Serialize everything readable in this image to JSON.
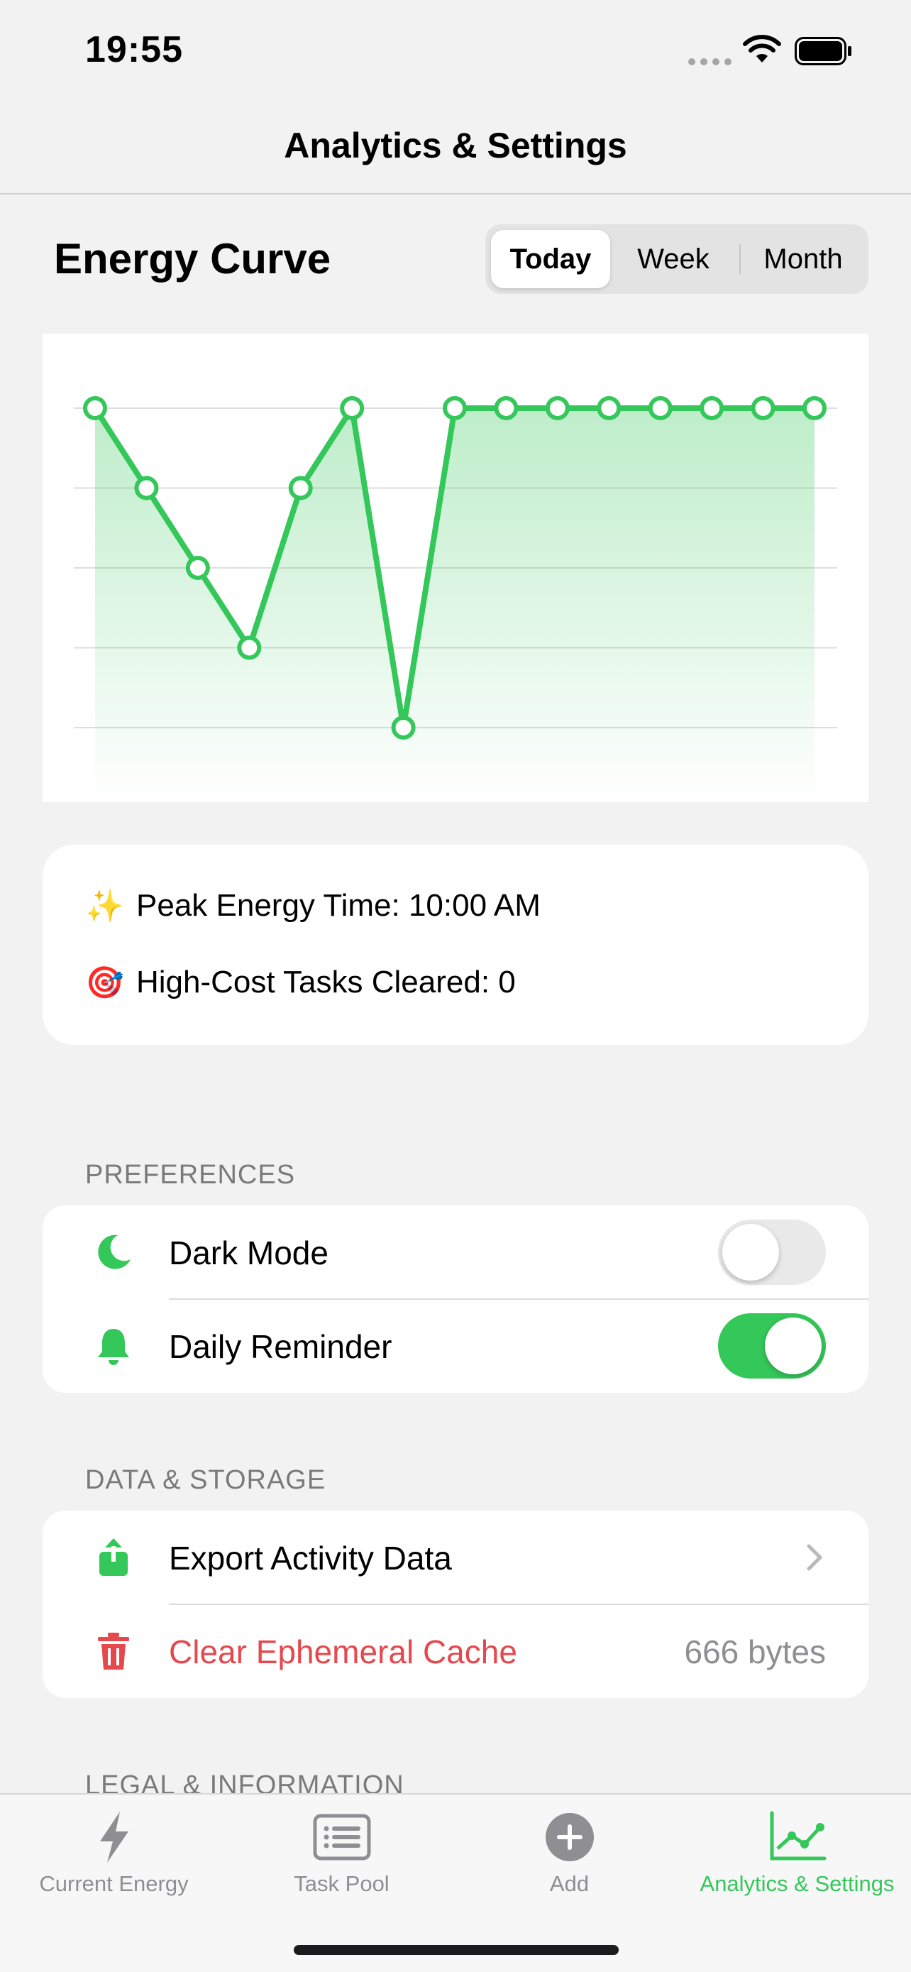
{
  "status_bar": {
    "time": "19:55"
  },
  "nav": {
    "title": "Analytics & Settings"
  },
  "energy": {
    "title": "Energy Curve",
    "segments": [
      "Today",
      "Week",
      "Month"
    ],
    "selected_segment": "Today"
  },
  "chart_data": {
    "type": "line",
    "x": [
      1,
      2,
      3,
      4,
      5,
      6,
      7,
      8,
      9,
      10,
      11,
      12,
      13,
      14,
      15
    ],
    "series": [
      {
        "values": [
          5,
          4,
          3,
          2,
          4,
          5,
          1,
          5,
          5,
          5,
          5,
          5,
          5,
          5,
          5
        ]
      }
    ],
    "ylim": [
      1,
      5
    ],
    "grid": true,
    "area_fill": true,
    "color": "#34c759"
  },
  "stats": {
    "peak": {
      "icon": "✨",
      "text": "Peak Energy Time: 10:00 AM"
    },
    "high_cost": {
      "icon": "🎯",
      "text": "High-Cost Tasks Cleared: 0"
    }
  },
  "preferences": {
    "header": "PREFERENCES",
    "dark_mode": {
      "label": "Dark Mode",
      "icon": "moon-icon",
      "enabled": false
    },
    "daily_reminder": {
      "label": "Daily Reminder",
      "icon": "bell-icon",
      "enabled": true
    }
  },
  "data_storage": {
    "header": "DATA & STORAGE",
    "export": {
      "label": "Export Activity Data",
      "icon": "share-icon"
    },
    "clear_cache": {
      "label": "Clear Ephemeral Cache",
      "value": "666 bytes",
      "icon": "trash-icon"
    }
  },
  "legal": {
    "header": "LEGAL & INFORMATION"
  },
  "tabs": [
    {
      "label": "Current Energy",
      "icon": "bolt-icon"
    },
    {
      "label": "Task Pool",
      "icon": "list-icon"
    },
    {
      "label": "Add",
      "icon": "plus-circle-icon"
    },
    {
      "label": "Analytics & Settings",
      "icon": "chart-icon",
      "active": true
    }
  ],
  "colors": {
    "accent": "#34c759",
    "destructive": "#e5484d",
    "background": "#f2f2f2"
  }
}
